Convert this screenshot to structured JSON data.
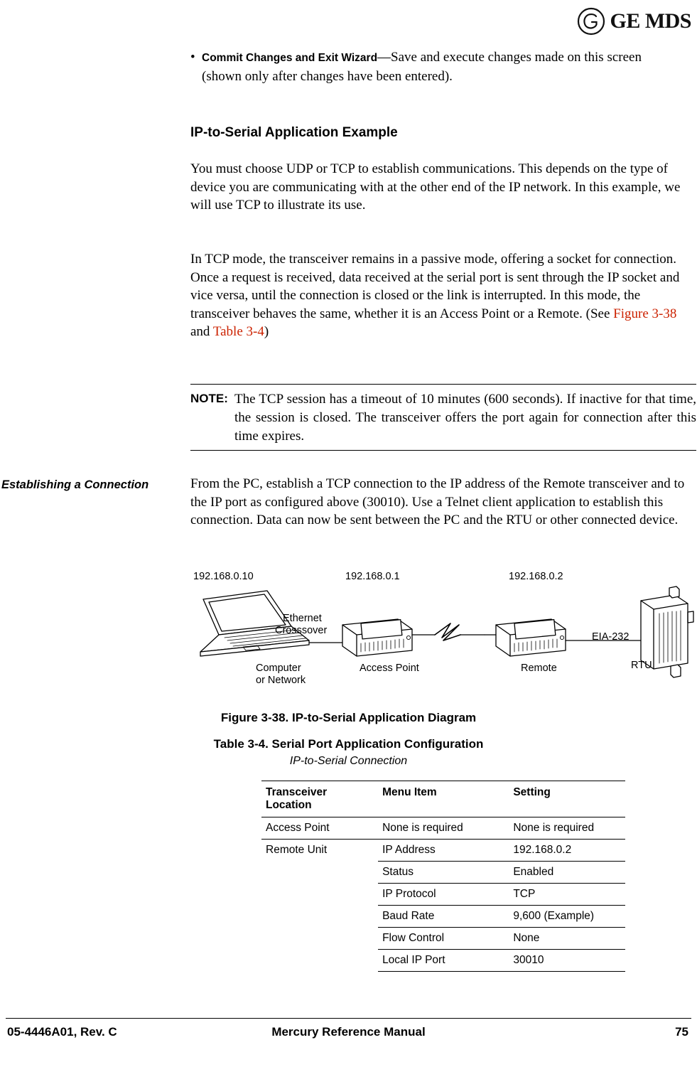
{
  "logo": {
    "text": "GE MDS",
    "mark": "ge-monogram"
  },
  "bullet": {
    "bold_label": "Commit Changes and Exit Wizard",
    "dash": "—",
    "rest": "Save and execute changes made on this screen (shown only after changes have been entered)."
  },
  "section_heading": "IP-to-Serial Application Example",
  "paragraphs": {
    "p1": "You must choose UDP or TCP to establish communications. This depends on the type of device you are communicating with at the other end of the IP network. In this example, we will use TCP to illustrate its use.",
    "p2_a": "In TCP mode, the transceiver remains in a passive mode, offering a socket for connection. Once a request is received, data received at the serial port is sent through the IP socket and vice versa, until the connection is closed or the link is interrupted. In this mode, the transceiver behaves the same, whether it is an Access Point or a Remote. (See ",
    "p2_link1": "Figure 3-38",
    "p2_mid": " and ",
    "p2_link2": "Table 3-4",
    "p2_end": ")",
    "p3": "From the PC, establish a TCP connection to the IP address of the Remote transceiver and to the IP port as configured above (30010). Use a Telnet client application to establish this connection. Data can now be sent between the PC and the RTU or other connected device."
  },
  "note": {
    "label": "NOTE:",
    "text": "The TCP session has a timeout of 10 minutes (600 seconds). If inactive for that time, the session is closed. The transceiver offers the port again for connection after this time expires."
  },
  "side_heading": "Establishing a Connection",
  "diagram": {
    "ip_left": "192.168.0.10",
    "ip_mid": "192.168.0.1",
    "ip_right": "192.168.0.2",
    "ethernet_line1": "Ethernet",
    "ethernet_line2": "Crosssover",
    "computer_line1": "Computer",
    "computer_line2": "or Network",
    "access_point": "Access Point",
    "remote": "Remote",
    "eia": "EIA-232",
    "rtu": "RTU"
  },
  "figure_caption": "Figure 3-38. IP-to-Serial Application Diagram",
  "table_caption": "Table 3-4. Serial Port Application Configuration",
  "table_subcaption": "IP-to-Serial Connection",
  "table": {
    "headers": [
      "Transceiver Location",
      "Menu Item",
      "Setting"
    ],
    "header_line1": "Transceiver",
    "header_line2": "Location",
    "rows": [
      {
        "location": "Access Point",
        "item": "None is required",
        "setting": "None is required"
      },
      {
        "location": "Remote Unit",
        "item": "IP Address",
        "setting": "192.168.0.2"
      },
      {
        "location": "",
        "item": "Status",
        "setting": "Enabled"
      },
      {
        "location": "",
        "item": "IP Protocol",
        "setting": "TCP"
      },
      {
        "location": "",
        "item": "Baud Rate",
        "setting": "9,600 (Example)"
      },
      {
        "location": "",
        "item": "Flow Control",
        "setting": "None"
      },
      {
        "location": "",
        "item": "Local IP Port",
        "setting": "30010"
      }
    ]
  },
  "footer": {
    "left": "05-4446A01, Rev. C",
    "center": "Mercury Reference Manual",
    "right": "75"
  }
}
